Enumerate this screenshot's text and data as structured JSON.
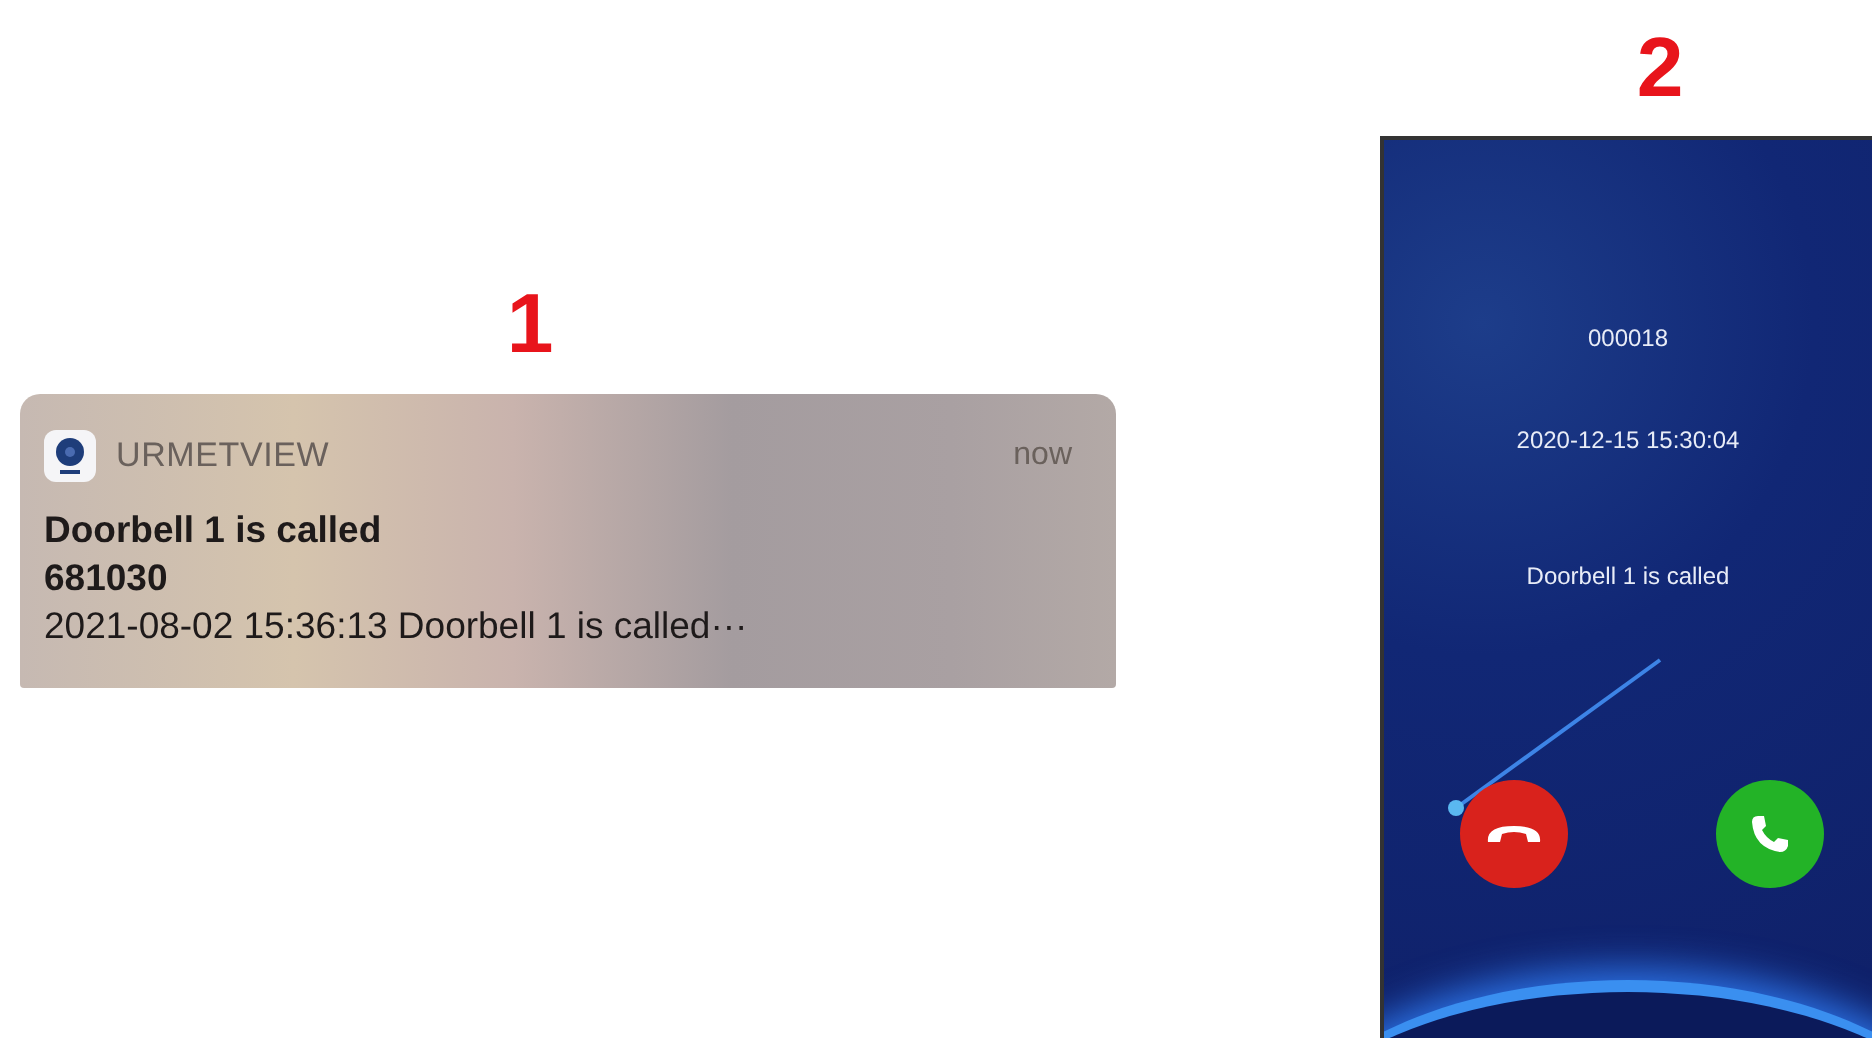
{
  "figures": [
    {
      "label": "1",
      "notification": {
        "app": "URMETVIEW",
        "time": "now",
        "title": "Doorbell 1 is called",
        "subtitle": "681030",
        "body": "2021-08-02 15:36:13 Doorbell 1 is called···"
      }
    },
    {
      "label": "2",
      "call_screen": {
        "caller_id": "000018",
        "datetime": "2020-12-15 15:30:04",
        "message": "Doorbell 1 is called"
      }
    }
  ]
}
